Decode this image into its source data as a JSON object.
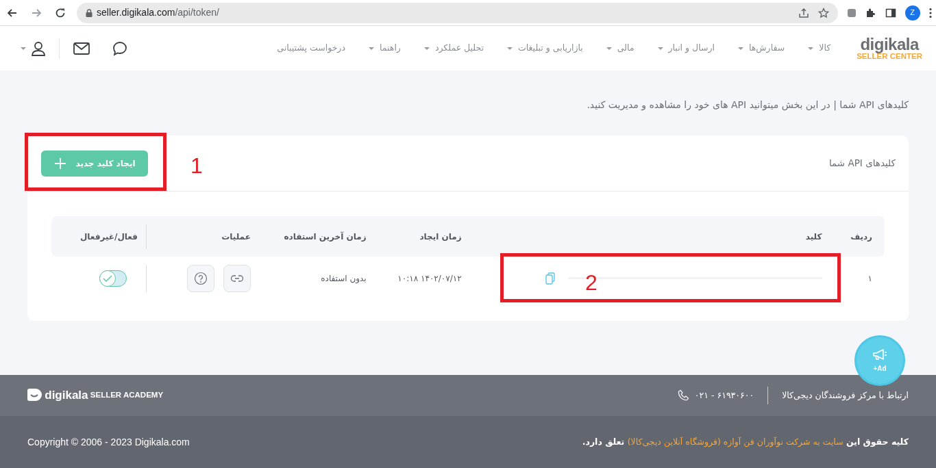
{
  "browser": {
    "url_host": "seller.digikala.com",
    "url_path": "/api/token/",
    "profile_initial": "Z",
    "forward_disabled": true
  },
  "header": {
    "logo": {
      "name": "digikala",
      "subtitle": "SELLER CENTER"
    },
    "nav": [
      {
        "label": "کالا",
        "dropdown": true
      },
      {
        "label": "سفارش‌ها",
        "dropdown": true
      },
      {
        "label": "ارسال و انبار",
        "dropdown": true
      },
      {
        "label": "مالی",
        "dropdown": true
      },
      {
        "label": "بازاریابی و تبلیغات",
        "dropdown": true
      },
      {
        "label": "تحلیل عملکرد",
        "dropdown": true
      },
      {
        "label": "راهنما",
        "dropdown": true
      },
      {
        "label": "درخواست پشتیبانی",
        "dropdown": false
      }
    ]
  },
  "page_intro": "کلیدهای API شما | در این بخش میتوانید API های خود را مشاهده و مدیریت کنید.",
  "card": {
    "title": "کلیدهای API شما",
    "create_button": "ایجاد کلید جدید",
    "table": {
      "columns": [
        "ردیف",
        "کلید",
        "زمان ایجاد",
        "زمان آخرین استفاده",
        "عملیات",
        "فعال/غیرفعال"
      ],
      "rows": [
        {
          "index": "۱",
          "created": "۱۴۰۲/۰۷/۱۲ ۱۰:۱۸",
          "last_used": "بدون استفاده",
          "active": true
        }
      ]
    }
  },
  "annotations": [
    {
      "label": "1"
    },
    {
      "label": "2"
    }
  ],
  "ad_button": {
    "label": "+Ad"
  },
  "footer": {
    "contact_label": "ارتباط با مرکز فروشندگان دیجی‌کالا",
    "phone": "۰۲۱ - ۶۱۹۳۰۶۰۰",
    "academy_logo": {
      "name": "digikala",
      "subtitle": "SELLER ACADEMY"
    },
    "rights_prefix": "کلیه حقوق این",
    "rights_link": "سایت به شرکت نوآوران فن آوازه (فروشگاه آنلاین دیجی‌کالا)",
    "rights_suffix": "تعلق دارد.",
    "copyright": "Copyright © 2006 - 2023 Digikala.com"
  }
}
